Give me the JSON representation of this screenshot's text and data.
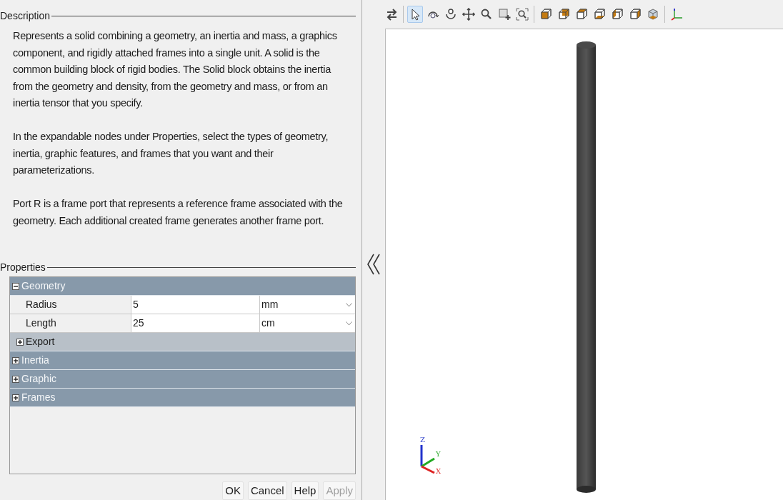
{
  "description": {
    "title": "Description",
    "paragraphs": [
      "Represents a solid combining a geometry, an inertia and mass, a graphics component, and rigidly attached frames into a single unit. A solid is the common building block of rigid bodies. The Solid block obtains the inertia from the geometry and density, from the geometry and mass, or from an inertia tensor that you specify.",
      "In the expandable nodes under Properties, select the types of geometry, inertia, graphic features, and frames that you want and their parameterizations.",
      "Port R is a frame port that represents a reference frame associated with the geometry. Each additional created frame generates another frame port."
    ]
  },
  "properties": {
    "title": "Properties",
    "nodes": [
      {
        "label": "Geometry",
        "expanded": true,
        "params": [
          {
            "name": "Radius",
            "value": "5",
            "unit": "mm"
          },
          {
            "name": "Length",
            "value": "25",
            "unit": "cm"
          }
        ],
        "children": [
          {
            "label": "Export",
            "expanded": false
          }
        ]
      },
      {
        "label": "Inertia",
        "expanded": false
      },
      {
        "label": "Graphic",
        "expanded": false
      },
      {
        "label": "Frames",
        "expanded": false
      }
    ]
  },
  "buttons": [
    {
      "label": "OK",
      "disabled": false
    },
    {
      "label": "Cancel",
      "disabled": false
    },
    {
      "label": "Help",
      "disabled": false
    },
    {
      "label": "Apply",
      "disabled": true
    }
  ],
  "toolbar_buttons": [
    {
      "selected": false
    },
    {
      "selected": true
    },
    {
      "selected": false
    },
    {
      "selected": false
    },
    {
      "selected": false
    },
    {
      "selected": false
    },
    {
      "selected": false
    },
    {
      "selected": false
    },
    {
      "selected": false
    },
    {
      "selected": false
    },
    {
      "selected": false
    },
    {
      "selected": false
    },
    {
      "selected": false
    },
    {
      "selected": false
    },
    {
      "selected": false
    },
    {
      "selected": false
    }
  ],
  "viewport": {
    "axis_labels": [
      "Z",
      "Y",
      "X"
    ]
  }
}
